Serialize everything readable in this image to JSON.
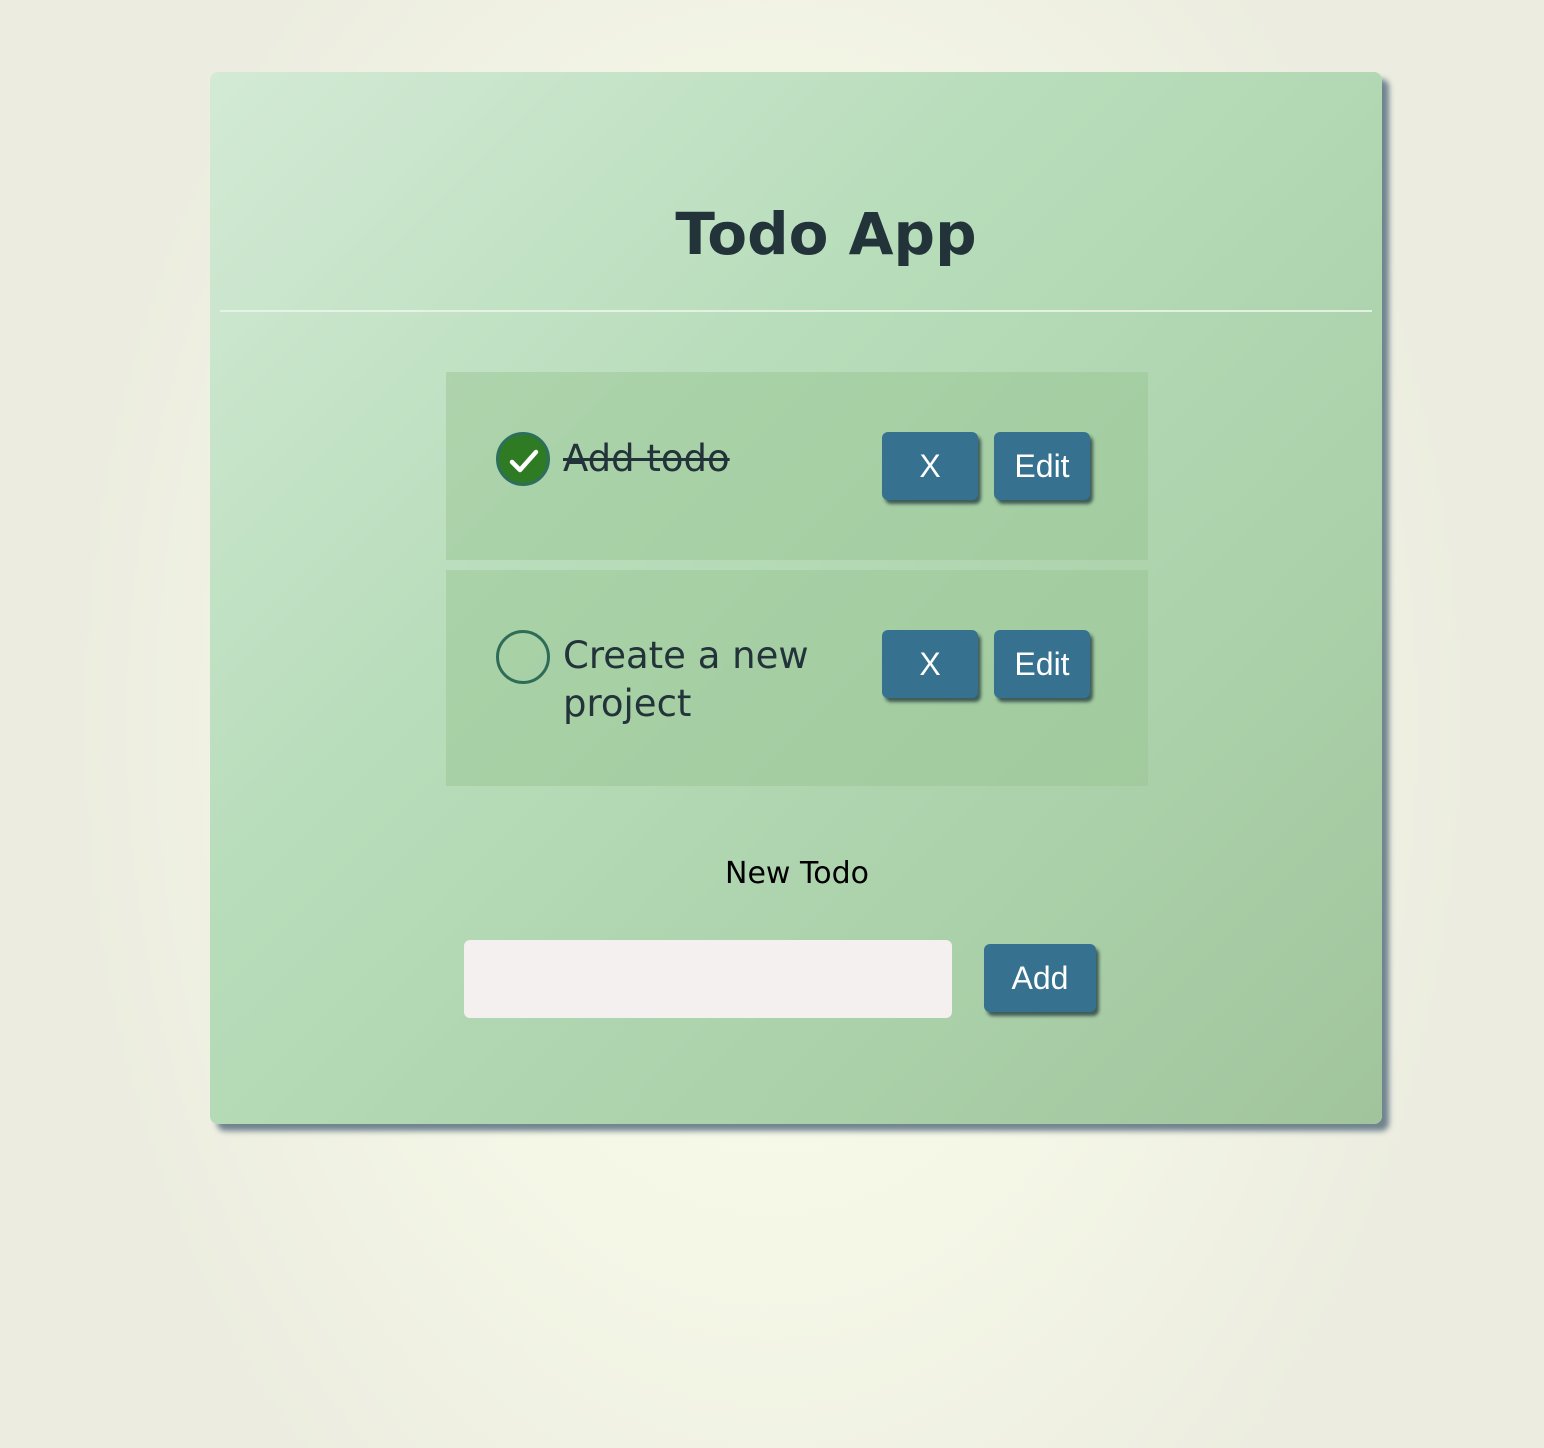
{
  "app": {
    "title": "Todo App"
  },
  "todos": [
    {
      "text": "Add todo",
      "completed": true,
      "delete_label": "X",
      "edit_label": "Edit"
    },
    {
      "text": "Create a new project",
      "completed": false,
      "delete_label": "X",
      "edit_label": "Edit"
    }
  ],
  "new_todo": {
    "label": "New Todo",
    "value": "",
    "placeholder": "",
    "add_label": "Add"
  },
  "colors": {
    "button": "#36728f",
    "check_done": "#2e7b24",
    "title_text": "#23333a"
  },
  "icons": {
    "completed_check": "checkmark-icon"
  }
}
